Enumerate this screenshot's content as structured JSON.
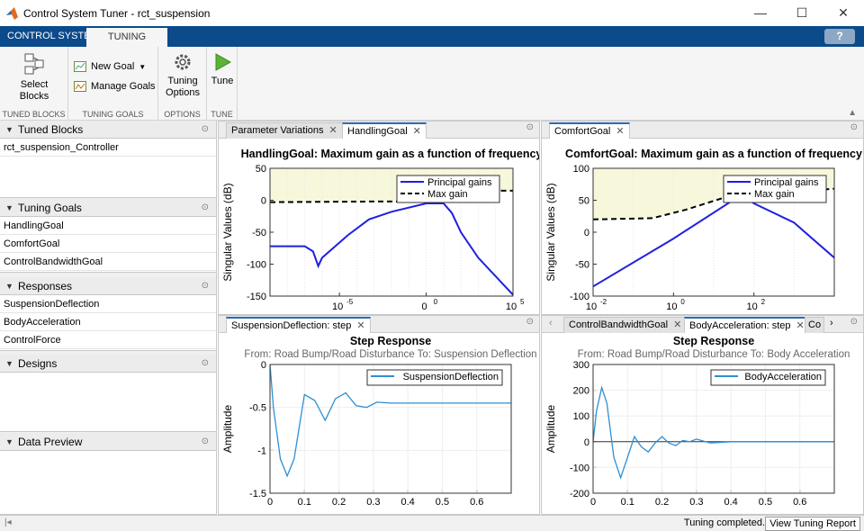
{
  "window": {
    "title": "Control System Tuner - rct_suspension",
    "minimize": "—",
    "maximize": "☐",
    "close": "✕"
  },
  "tabs": {
    "control_system": "CONTROL SYSTEM",
    "tuning": "TUNING",
    "help": "?"
  },
  "ribbon": {
    "select_blocks": "Select Blocks",
    "tuned_blocks_group": "TUNED BLOCKS",
    "new_goal": "New Goal",
    "manage_goals": "Manage Goals",
    "tuning_goals_group": "TUNING GOALS",
    "tuning_options": "Tuning Options",
    "options_group": "OPTIONS",
    "tune": "Tune",
    "tune_group": "TUNE"
  },
  "left": {
    "tuned_blocks": {
      "title": "Tuned Blocks",
      "items": [
        "rct_suspension_Controller"
      ]
    },
    "tuning_goals": {
      "title": "Tuning Goals",
      "items": [
        "HandlingGoal",
        "ComfortGoal",
        "ControlBandwidthGoal"
      ]
    },
    "responses": {
      "title": "Responses",
      "items": [
        "SuspensionDeflection",
        "BodyAcceleration",
        "ControlForce"
      ]
    },
    "designs": {
      "title": "Designs"
    },
    "data_preview": {
      "title": "Data Preview"
    }
  },
  "docs": {
    "tl_tabs": [
      "Parameter Variations",
      "HandlingGoal"
    ],
    "tr_tabs": [
      "ComfortGoal"
    ],
    "bl_tabs": [
      "SuspensionDeflection: step"
    ],
    "br_tabs": [
      "ControlBandwidthGoal",
      "BodyAcceleration: step",
      "Co"
    ]
  },
  "status": {
    "text": "Tuning completed.",
    "report_button": "View Tuning Report"
  },
  "chart_data": [
    {
      "id": "handling",
      "type": "line",
      "title": "HandlingGoal: Maximum gain as a function of frequency",
      "ylabel": "Singular Values (dB)",
      "xscale": "log",
      "xlim": [
        1e-09,
        100000.0
      ],
      "ylim": [
        -150,
        50
      ],
      "yticks": [
        "50",
        "0",
        "-50",
        "-100",
        "-150"
      ],
      "xticks": [
        "10",
        "0",
        "10"
      ],
      "xtick_exps": [
        "-5",
        "0",
        "5"
      ],
      "legend": [
        "Principal gains",
        "Max gain"
      ],
      "series": [
        {
          "name": "Principal gains",
          "x": [
            1e-09,
            1e-07,
            3e-07,
            6e-07,
            1e-06,
            3e-05,
            0.0005,
            0.01,
            1,
            10,
            30,
            100,
            1000,
            100000.0
          ],
          "y": [
            -72,
            -72,
            -80,
            -103,
            -90,
            -55,
            -30,
            -18,
            -5,
            -5,
            -20,
            -50,
            -90,
            -148
          ]
        },
        {
          "name": "Max gain",
          "x": [
            1e-09,
            0.001,
            1,
            10,
            100000.0
          ],
          "y": [
            -3,
            -2,
            -2,
            15,
            15
          ]
        }
      ]
    },
    {
      "id": "comfort",
      "type": "line",
      "title": "ComfortGoal: Maximum gain as a function of frequency",
      "ylabel": "Singular Values (dB)",
      "xscale": "log",
      "xlim": [
        0.01,
        10000
      ],
      "ylim": [
        -100,
        100
      ],
      "yticks": [
        "100",
        "50",
        "0",
        "-50",
        "-100"
      ],
      "xticks": [
        "10",
        "10",
        "10"
      ],
      "xtick_exps": [
        "-2",
        "0",
        "2"
      ],
      "legend": [
        "Principal gains",
        "Max gain"
      ],
      "series": [
        {
          "name": "Principal gains",
          "x": [
            0.01,
            1,
            30,
            60,
            100,
            1000,
            10000
          ],
          "y": [
            -85,
            -10,
            50,
            55,
            45,
            15,
            -40
          ]
        },
        {
          "name": "Max gain",
          "x": [
            0.01,
            0.3,
            2,
            20,
            100,
            10000
          ],
          "y": [
            20,
            22,
            35,
            55,
            60,
            68
          ]
        }
      ]
    },
    {
      "id": "suspension",
      "type": "line",
      "title": "Step Response",
      "subtitle": "From: Road Bump/Road Disturbance  To: Suspension Deflection",
      "ylabel": "Amplitude",
      "xlim": [
        0,
        0.7
      ],
      "ylim": [
        -1.5,
        0
      ],
      "yticks": [
        "0",
        "-0.5",
        "-1",
        "-1.5"
      ],
      "xticks": [
        "0",
        "0.1",
        "0.2",
        "0.3",
        "0.4",
        "0.5",
        "0.6"
      ],
      "legend": [
        "SuspensionDeflection"
      ],
      "series": [
        {
          "name": "SuspensionDeflection",
          "x": [
            0,
            0.01,
            0.03,
            0.05,
            0.07,
            0.1,
            0.13,
            0.16,
            0.19,
            0.22,
            0.25,
            0.28,
            0.31,
            0.35,
            0.4,
            0.5,
            0.6,
            0.7
          ],
          "y": [
            0,
            -0.5,
            -1.1,
            -1.3,
            -1.1,
            -0.35,
            -0.42,
            -0.65,
            -0.4,
            -0.33,
            -0.48,
            -0.5,
            -0.44,
            -0.45,
            -0.45,
            -0.45,
            -0.45,
            -0.45
          ]
        }
      ]
    },
    {
      "id": "body",
      "type": "line",
      "title": "Step Response",
      "subtitle": "From: Road Bump/Road Disturbance  To: Body Acceleration",
      "ylabel": "Amplitude",
      "xlim": [
        0,
        0.7
      ],
      "ylim": [
        -200,
        300
      ],
      "yticks": [
        "300",
        "200",
        "100",
        "0",
        "-100",
        "-200"
      ],
      "xticks": [
        "0",
        "0.1",
        "0.2",
        "0.3",
        "0.4",
        "0.5",
        "0.6"
      ],
      "legend": [
        "BodyAcceleration"
      ],
      "series": [
        {
          "name": "BodyAcceleration",
          "x": [
            0,
            0.01,
            0.025,
            0.04,
            0.06,
            0.08,
            0.1,
            0.12,
            0.14,
            0.16,
            0.18,
            0.2,
            0.22,
            0.24,
            0.26,
            0.28,
            0.3,
            0.34,
            0.4,
            0.5,
            0.7
          ],
          "y": [
            0,
            120,
            210,
            150,
            -60,
            -140,
            -60,
            20,
            -20,
            -40,
            -5,
            20,
            -5,
            -15,
            5,
            0,
            10,
            -5,
            0,
            0,
            0
          ]
        }
      ]
    }
  ]
}
